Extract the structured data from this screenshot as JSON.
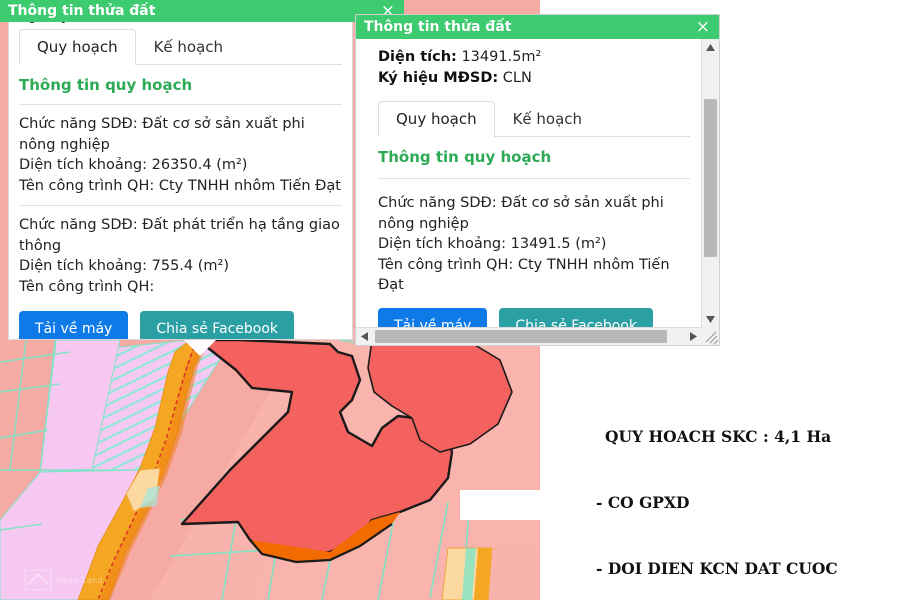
{
  "annotation": {
    "lines": [
      "QUY HOACH SKC : 4,1 Ha",
      "- CO GPXD",
      "- DOI DIEN KCN DAT CUOC"
    ]
  },
  "map": {
    "watermark": "Meey Land",
    "watermark_secondary": "Meey Land"
  },
  "left_panel": {
    "title": "Thông tin thửa đất",
    "close_label": "×",
    "clipped_line": "Ký hiệu MĐSD: SKC-ONT : CLN",
    "tabs": [
      {
        "label": "Quy hoạch",
        "active": true
      },
      {
        "label": "Kế hoạch",
        "active": false
      }
    ],
    "section_title": "Thông tin quy hoạch",
    "blocks": [
      {
        "function": "Chức năng SDĐ: Đất cơ sở sản xuất phi nông nghiệp",
        "area": "Diện tích khoảng: 26350.4 (m²)",
        "project": "Tên công trình QH: Cty TNHH nhôm Tiến Đạt"
      },
      {
        "function": "Chức năng SDĐ: Đất phát triển hạ tầng giao thông",
        "area": "Diện tích khoảng: 755.4 (m²)",
        "project": "Tên công trình QH:"
      }
    ],
    "buttons": {
      "download": "Tải về máy",
      "share": "Chia sẻ Facebook"
    }
  },
  "right_panel": {
    "title": "Thông tin thửa đất",
    "close_label": "×",
    "meta": [
      {
        "label": "Diện tích:",
        "value": "13491.5m²"
      },
      {
        "label": "Ký hiệu MĐSD:",
        "value": "CLN"
      }
    ],
    "tabs": [
      {
        "label": "Quy hoạch",
        "active": true
      },
      {
        "label": "Kế hoạch",
        "active": false
      }
    ],
    "section_title": "Thông tin quy hoạch",
    "blocks": [
      {
        "function": "Chức năng SDĐ: Đất cơ sở sản xuất phi nông nghiệp",
        "area": "Diện tích khoảng: 13491.5 (m²)",
        "project": "Tên công trình QH: Cty TNHH nhôm Tiến Đạt"
      }
    ],
    "buttons": {
      "download": "Tải về máy",
      "share": "Chia sẻ Facebook"
    }
  },
  "colors": {
    "titlebar_green": "#3ccb6e",
    "section_green": "#2eaa57",
    "button_blue": "#0d7ae8",
    "button_teal": "#2a9fa4",
    "map_pink": "#f5a9a3",
    "map_red": "#f4625f",
    "map_violet": "#f5c6ef",
    "map_orange": "#f5a623",
    "map_cyan_line": "#7fe3c4"
  }
}
